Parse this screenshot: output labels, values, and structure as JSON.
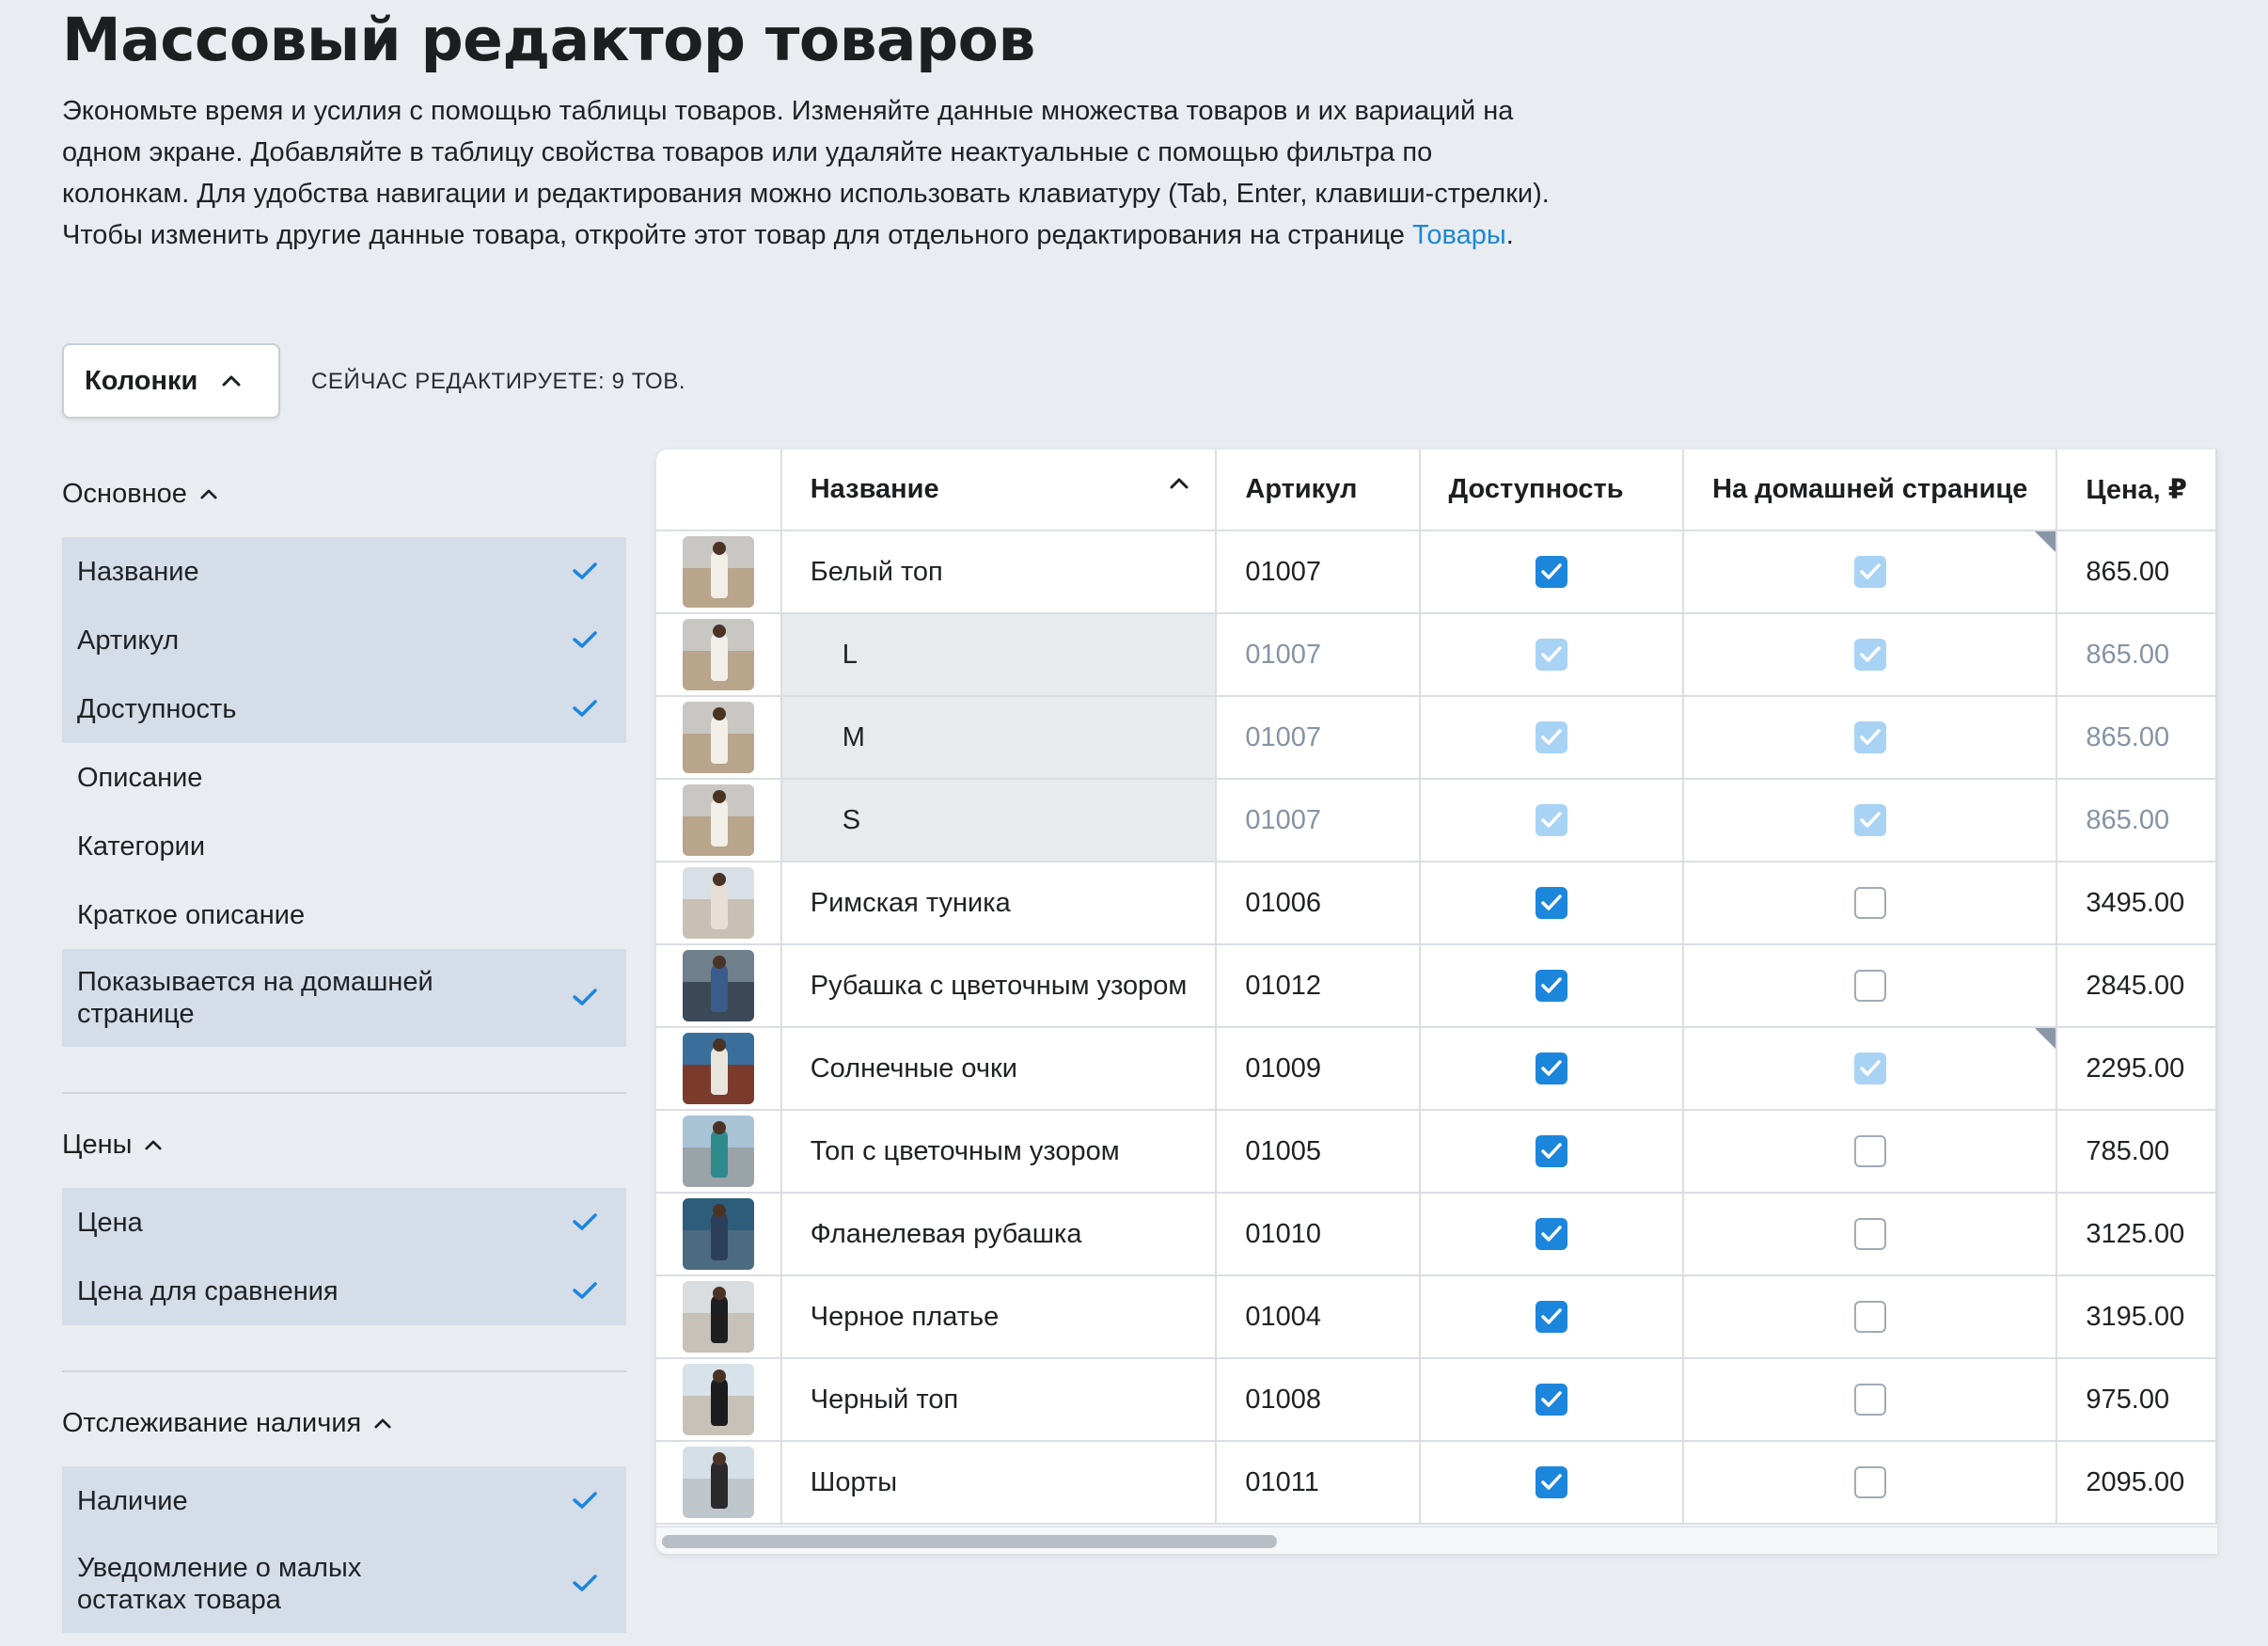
{
  "page": {
    "title": "Массовый редактор товаров",
    "intro": "Экономьте время и усилия с помощью таблицы товаров. Изменяйте данные множества товаров и их вариаций на одном экране. Добавляйте в таблицу свойства товаров или удаляйте неактуальные с помощью фильтра по колонкам. Для удобства навигации и редактирования можно использовать клавиатуру (Tab, Enter, клавиши-стрелки). Чтобы изменить другие данные товара, откройте этот товар для отдельного редактирования на странице",
    "intro_link": "Товары",
    "intro_end": "."
  },
  "toolbar": {
    "columns_label": "Колонки",
    "editing_info": "СЕЙЧАС РЕДАКТИРУЕТЕ: 9 ТОВ."
  },
  "columns_panel": {
    "groups": [
      {
        "title": "Основное",
        "options": [
          {
            "label": "Название",
            "checked": true
          },
          {
            "label": "Артикул",
            "checked": true
          },
          {
            "label": "Доступность",
            "checked": true
          },
          {
            "label": "Описание",
            "checked": false
          },
          {
            "label": "Категории",
            "checked": false
          },
          {
            "label": "Краткое описание",
            "checked": false
          },
          {
            "label": "Показывается на домашней странице",
            "checked": true
          }
        ]
      },
      {
        "title": "Цены",
        "options": [
          {
            "label": "Цена",
            "checked": true
          },
          {
            "label": "Цена для сравнения",
            "checked": true
          }
        ]
      },
      {
        "title": "Отслеживание наличия",
        "options": [
          {
            "label": "Наличие",
            "checked": true
          },
          {
            "label": "Уведомление о малых остатках товара",
            "checked": true
          }
        ]
      }
    ]
  },
  "table": {
    "headers": [
      "Название",
      "Артикул",
      "Доступность",
      "На домашней странице",
      "Цена, ₽"
    ],
    "rows": [
      {
        "name": "Белый топ",
        "sku": "01007",
        "available": "checked",
        "home": "light",
        "price": "865.00",
        "variant": false,
        "marked": true
      },
      {
        "name": "L",
        "sku": "01007",
        "available": "light",
        "home": "light",
        "price": "865.00",
        "variant": true,
        "marked": false
      },
      {
        "name": "M",
        "sku": "01007",
        "available": "light",
        "home": "light",
        "price": "865.00",
        "variant": true,
        "marked": false
      },
      {
        "name": "S",
        "sku": "01007",
        "available": "light",
        "home": "light",
        "price": "865.00",
        "variant": true,
        "marked": false
      },
      {
        "name": "Римская туника",
        "sku": "01006",
        "available": "checked",
        "home": "empty",
        "price": "3495.00",
        "variant": false,
        "marked": false
      },
      {
        "name": "Рубашка с цветочным узором",
        "sku": "01012",
        "available": "checked",
        "home": "empty",
        "price": "2845.00",
        "variant": false,
        "marked": false
      },
      {
        "name": "Солнечные очки",
        "sku": "01009",
        "available": "checked",
        "home": "light",
        "price": "2295.00",
        "variant": false,
        "marked": true
      },
      {
        "name": "Топ с цветочным узором",
        "sku": "01005",
        "available": "checked",
        "home": "empty",
        "price": "785.00",
        "variant": false,
        "marked": false
      },
      {
        "name": "Фланелевая рубашка",
        "sku": "01010",
        "available": "checked",
        "home": "empty",
        "price": "3125.00",
        "variant": false,
        "marked": false
      },
      {
        "name": "Черное платье",
        "sku": "01004",
        "available": "checked",
        "home": "empty",
        "price": "3195.00",
        "variant": false,
        "marked": false
      },
      {
        "name": "Черный топ",
        "sku": "01008",
        "available": "checked",
        "home": "empty",
        "price": "975.00",
        "variant": false,
        "marked": false
      },
      {
        "name": "Шорты",
        "sku": "01011",
        "available": "checked",
        "home": "empty",
        "price": "2095.00",
        "variant": false,
        "marked": false
      }
    ]
  },
  "colors": {
    "accent": "#1c86dc",
    "check_light": "#a8d3f5",
    "link": "#1b88d6",
    "selected_option_bg": "#d5dde8"
  }
}
